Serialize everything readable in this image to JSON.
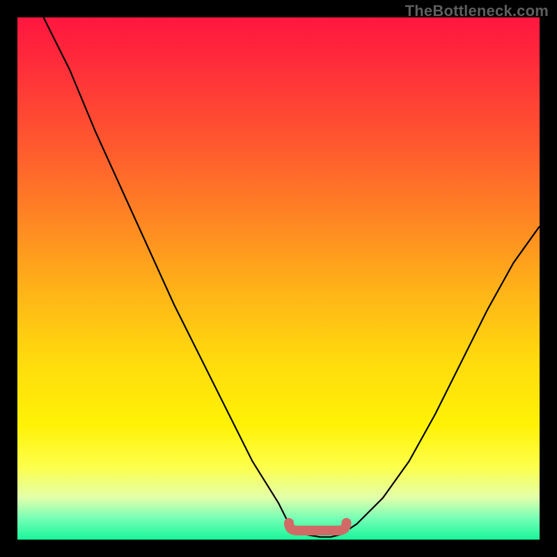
{
  "watermark": "TheBottleneck.com",
  "chart_data": {
    "type": "line",
    "title": "",
    "xlabel": "",
    "ylabel": "",
    "xlim": [
      0,
      100
    ],
    "ylim": [
      0,
      100
    ],
    "grid": false,
    "legend": false,
    "series": [
      {
        "name": "bottleneck-curve",
        "x": [
          5,
          10,
          15,
          20,
          25,
          30,
          35,
          40,
          45,
          50,
          52,
          55,
          58,
          60,
          62,
          65,
          70,
          75,
          80,
          85,
          90,
          95,
          100
        ],
        "y": [
          100,
          90,
          78,
          67,
          56,
          45,
          35,
          25,
          15,
          7,
          3,
          1,
          0.5,
          0.5,
          1,
          3,
          8,
          15,
          24,
          34,
          44,
          53,
          60
        ]
      }
    ],
    "optimal_range": {
      "x_start": 52,
      "x_end": 63,
      "y": 2
    },
    "background_gradient": {
      "top": "#ff163f",
      "mid": "#ffd90e",
      "bottom": "#18f59a"
    }
  }
}
